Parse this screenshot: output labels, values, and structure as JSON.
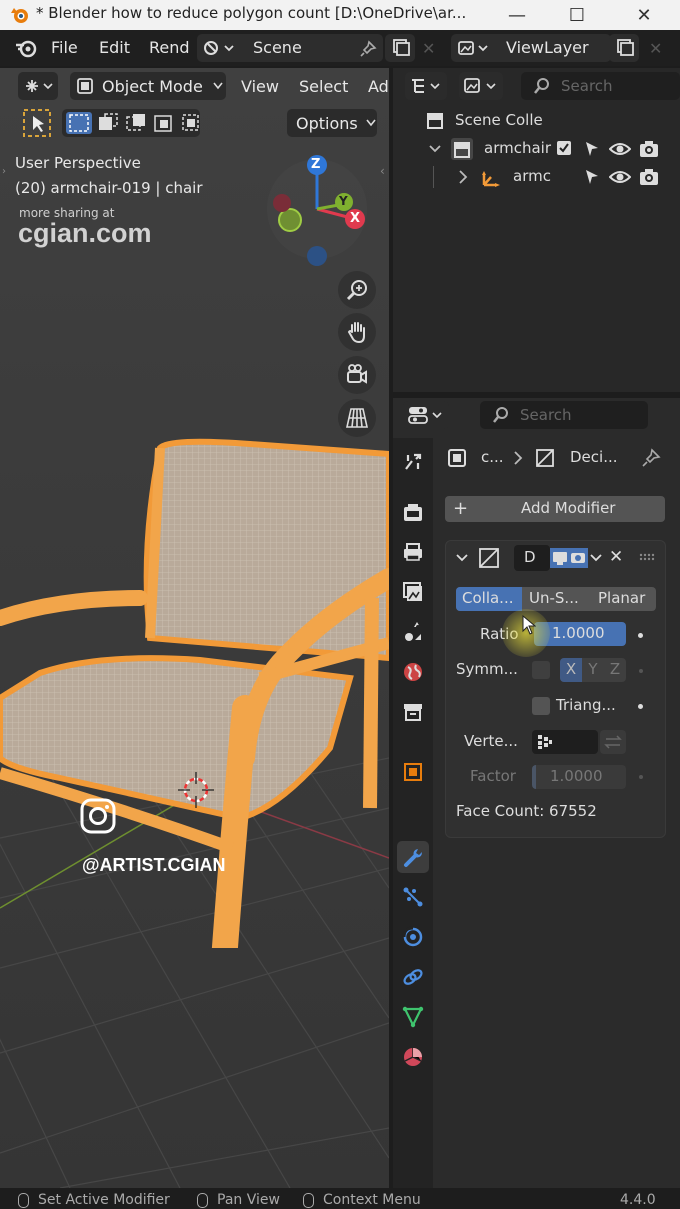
{
  "window": {
    "title": "* Blender how to reduce polygon count [D:\\OneDrive\\ar...",
    "controls": [
      "minimize",
      "maximize",
      "close"
    ]
  },
  "topbar": {
    "menus": [
      "File",
      "Edit",
      "Rend"
    ],
    "scene_label": "Scene",
    "viewlayer_label": "ViewLayer"
  },
  "viewport": {
    "mode": "Object Mode",
    "menus": [
      "View",
      "Select",
      "Ad"
    ],
    "options_label": "Options",
    "perspective": "User Perspective",
    "object_info": "(20) armchair-019 | chair",
    "watermark_small": "more sharing at",
    "watermark_large": "cgian.com",
    "instagram_handle": "@ARTIST.CGIAN",
    "gizmo": {
      "x": "X",
      "y": "Y",
      "z": "Z"
    }
  },
  "outliner": {
    "search_placeholder": "Search",
    "rows": [
      {
        "label": "Scene Colle"
      },
      {
        "label": "armchair"
      },
      {
        "label": "armc"
      }
    ]
  },
  "properties": {
    "search_placeholder": "Search",
    "breadcrumb": {
      "object": "c...",
      "modifier": "Deci..."
    },
    "add_modifier": "Add Modifier",
    "modifier": {
      "name": "D",
      "tabs": [
        "Colla...",
        "Un-S...",
        "Planar"
      ],
      "ratio_label": "Ratio",
      "ratio_value": "1.0000",
      "symmetry_label": "Symm...",
      "axes": [
        "X",
        "Y",
        "Z"
      ],
      "triangulate_label": "Triang...",
      "vertex_group_label": "Verte...",
      "factor_label": "Factor",
      "factor_value": "1.0000",
      "face_count": "Face Count: 67552"
    }
  },
  "statusbar": {
    "items": [
      "Set Active Modifier",
      "Pan View",
      "Context Menu"
    ],
    "version": "4.4.0"
  },
  "colors": {
    "accent": "#4772b3",
    "selection": "#f29a38",
    "bg": "#1d1d1d"
  }
}
